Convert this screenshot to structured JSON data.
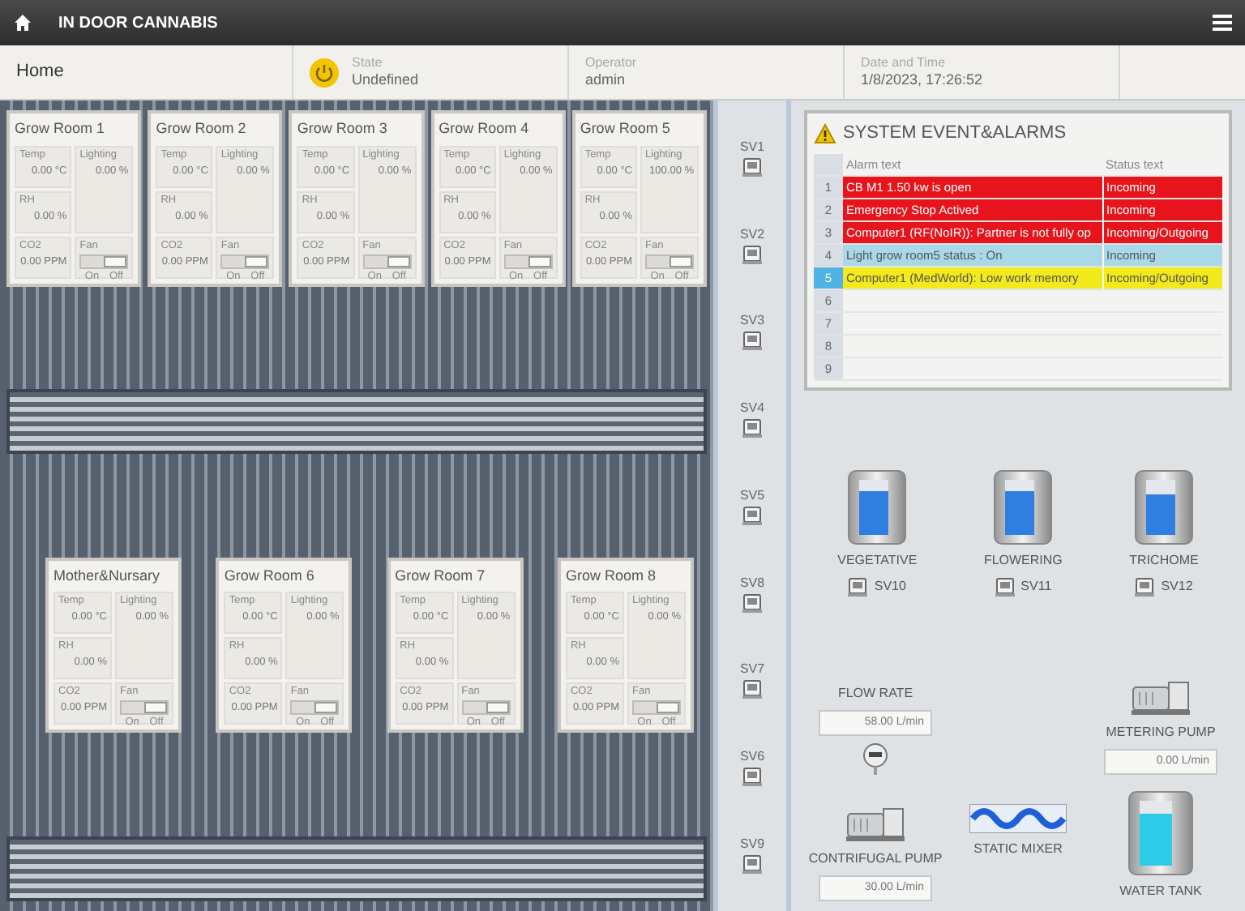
{
  "header": {
    "title": "IN DOOR CANNABIS"
  },
  "subheader": {
    "page": "Home",
    "state_label": "State",
    "state_value": "Undefined",
    "operator_label": "Operator",
    "operator_value": "admin",
    "datetime_label": "Date and Time",
    "datetime_value": "1/8/2023, 17:26:52"
  },
  "room_rows": [
    [
      {
        "name": "Grow Room 1",
        "temp_label": "Temp",
        "temp": "0.00 °C",
        "lighting_label": "Lighting",
        "lighting": "0.00 %",
        "rh_label": "RH",
        "rh": "0.00 %",
        "fan_label": "Fan",
        "fan_on": false,
        "on_label": "On",
        "off_label": "Off",
        "co2_label": "CO2",
        "co2": "0.00 PPM"
      },
      {
        "name": "Grow Room 2",
        "temp_label": "Temp",
        "temp": "0.00 °C",
        "lighting_label": "Lighting",
        "lighting": "0.00 %",
        "rh_label": "RH",
        "rh": "0.00 %",
        "fan_label": "Fan",
        "fan_on": false,
        "on_label": "On",
        "off_label": "Off",
        "co2_label": "CO2",
        "co2": "0.00 PPM"
      },
      {
        "name": "Grow Room 3",
        "temp_label": "Temp",
        "temp": "0.00 °C",
        "lighting_label": "Lighting",
        "lighting": "0.00 %",
        "rh_label": "RH",
        "rh": "0.00 %",
        "fan_label": "Fan",
        "fan_on": false,
        "on_label": "On",
        "off_label": "Off",
        "co2_label": "CO2",
        "co2": "0.00 PPM"
      },
      {
        "name": "Grow Room 4",
        "temp_label": "Temp",
        "temp": "0.00 °C",
        "lighting_label": "Lighting",
        "lighting": "0.00 %",
        "rh_label": "RH",
        "rh": "0.00 %",
        "fan_label": "Fan",
        "fan_on": false,
        "on_label": "On",
        "off_label": "Off",
        "co2_label": "CO2",
        "co2": "0.00 PPM"
      },
      {
        "name": "Grow Room 5",
        "temp_label": "Temp",
        "temp": "0.00 °C",
        "lighting_label": "Lighting",
        "lighting": "100.00 %",
        "rh_label": "RH",
        "rh": "0.00 %",
        "fan_label": "Fan",
        "fan_on": false,
        "on_label": "On",
        "off_label": "Off",
        "co2_label": "CO2",
        "co2": "0.00 PPM"
      }
    ],
    [
      {
        "name": "Mother&Nursary",
        "temp_label": "Temp",
        "temp": "0.00 °C",
        "lighting_label": "Lighting",
        "lighting": "0.00 %",
        "rh_label": "RH",
        "rh": "0.00 %",
        "fan_label": "Fan",
        "fan_on": false,
        "on_label": "On",
        "off_label": "Off",
        "co2_label": "CO2",
        "co2": "0.00 PPM"
      },
      {
        "name": "Grow Room 6",
        "temp_label": "Temp",
        "temp": "0.00 °C",
        "lighting_label": "Lighting",
        "lighting": "0.00 %",
        "rh_label": "RH",
        "rh": "0.00 %",
        "fan_label": "Fan",
        "fan_on": false,
        "on_label": "On",
        "off_label": "Off",
        "co2_label": "CO2",
        "co2": "0.00 PPM"
      },
      {
        "name": "Grow Room 7",
        "temp_label": "Temp",
        "temp": "0.00 °C",
        "lighting_label": "Lighting",
        "lighting": "0.00 %",
        "rh_label": "RH",
        "rh": "0.00 %",
        "fan_label": "Fan",
        "fan_on": false,
        "on_label": "On",
        "off_label": "Off",
        "co2_label": "CO2",
        "co2": "0.00 PPM"
      },
      {
        "name": "Grow Room 8",
        "temp_label": "Temp",
        "temp": "0.00 °C",
        "lighting_label": "Lighting",
        "lighting": "0.00 %",
        "rh_label": "RH",
        "rh": "0.00 %",
        "fan_label": "Fan",
        "fan_on": false,
        "on_label": "On",
        "off_label": "Off",
        "co2_label": "CO2",
        "co2": "0.00 PPM"
      }
    ]
  ],
  "valves": [
    {
      "label": "SV1"
    },
    {
      "label": "SV2"
    },
    {
      "label": "SV3"
    },
    {
      "label": "SV4"
    },
    {
      "label": "SV5"
    },
    {
      "label": "SV8"
    },
    {
      "label": "SV7"
    },
    {
      "label": "SV6"
    },
    {
      "label": "SV9"
    }
  ],
  "alarms": {
    "title": "SYSTEM EVENT&ALARMS",
    "columns": [
      "Alarm text",
      "Status text"
    ],
    "rows": [
      {
        "number": "1",
        "text": "CB M1 1.50 kw is open",
        "status": "Incoming",
        "color": "#e8141c",
        "selected": false
      },
      {
        "number": "2",
        "text": "Emergency Stop Actived",
        "status": "Incoming",
        "color": "#e8141c",
        "selected": false
      },
      {
        "number": "3",
        "text": "Computer1 (RF(NoIR)): Partner is not fully op",
        "status": "Incoming/Outgoing",
        "color": "#e8141c",
        "selected": false
      },
      {
        "number": "4",
        "text": "Light grow room5 status : On",
        "status": "Incoming",
        "color": "#a9d8e6",
        "selected": false
      },
      {
        "number": "5",
        "text": "Computer1 (MedWorld): Low work memory",
        "status": "Incoming/Outgoing",
        "color": "#f2ea1a",
        "selected": true
      },
      {
        "number": "6",
        "selected": false
      },
      {
        "number": "7",
        "selected": false
      },
      {
        "number": "8",
        "selected": false
      },
      {
        "number": "9",
        "selected": false
      }
    ]
  },
  "tanks": [
    {
      "label": "VEGETATIVE",
      "level": 0.8,
      "valve": "SV10"
    },
    {
      "label": "FLOWERING",
      "level": 0.8,
      "valve": "SV11"
    },
    {
      "label": "TRICHOME",
      "level": 0.75,
      "valve": "SV12"
    }
  ],
  "flow_rate": {
    "label": "FLOW RATE",
    "value": "58.00 L/min"
  },
  "metering_pump": {
    "label": "METERING PUMP",
    "value": "0.00 L/min"
  },
  "centrifugal_pump": {
    "label": "CONTRIFUGAL PUMP",
    "value": "30.00 L/min"
  },
  "static_mixer": {
    "label": "STATIC MIXER"
  },
  "water_tank": {
    "label": "WATER TANK",
    "level": 0.8
  }
}
